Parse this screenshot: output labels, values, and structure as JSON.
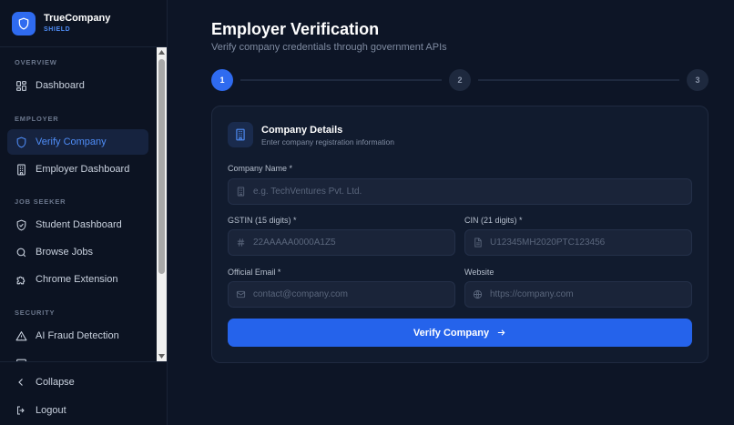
{
  "brand": {
    "name": "TrueCompany",
    "tagline": "SHIELD"
  },
  "sidebar": {
    "sections": [
      {
        "title": "OVERVIEW"
      },
      {
        "title": "EMPLOYER"
      },
      {
        "title": "JOB SEEKER"
      },
      {
        "title": "SECURITY"
      }
    ],
    "items": [
      {
        "label": "Dashboard",
        "icon": "grid-icon"
      },
      {
        "label": "Verify Company",
        "icon": "shield-icon",
        "active": true
      },
      {
        "label": "Employer Dashboard",
        "icon": "building-icon"
      },
      {
        "label": "Student Dashboard",
        "icon": "shield-check-icon"
      },
      {
        "label": "Browse Jobs",
        "icon": "search-icon"
      },
      {
        "label": "Chrome Extension",
        "icon": "puzzle-icon"
      },
      {
        "label": "AI Fraud Detection",
        "icon": "warning-icon"
      }
    ],
    "bottom": [
      {
        "label": "Collapse",
        "icon": "chevron-left-icon"
      },
      {
        "label": "Logout",
        "icon": "logout-icon"
      }
    ]
  },
  "page": {
    "title": "Employer Verification",
    "subtitle": "Verify company credentials through government APIs"
  },
  "stepper": {
    "steps": [
      "1",
      "2",
      "3"
    ],
    "current": 1
  },
  "card": {
    "title": "Company Details",
    "subtitle": "Enter company registration information",
    "fields": {
      "company_name": {
        "label": "Company Name *",
        "placeholder": "e.g. TechVentures Pvt. Ltd.",
        "value": ""
      },
      "gstin": {
        "label": "GSTIN (15 digits) *",
        "placeholder": "22AAAAA0000A1Z5",
        "value": ""
      },
      "cin": {
        "label": "CIN (21 digits) *",
        "placeholder": "U12345MH2020PTC123456",
        "value": ""
      },
      "email": {
        "label": "Official Email *",
        "placeholder": "contact@company.com",
        "value": ""
      },
      "website": {
        "label": "Website",
        "placeholder": "https://company.com",
        "value": ""
      }
    },
    "submit_label": "Verify Company"
  },
  "colors": {
    "accent": "#2563eb",
    "accent_light": "#4f8df7",
    "background": "#0d1526",
    "sidebar": "#0c1322"
  }
}
